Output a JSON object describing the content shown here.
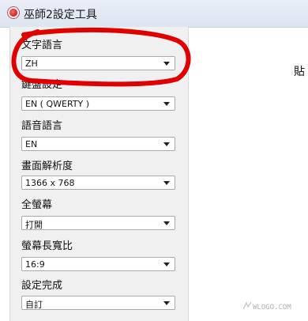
{
  "window": {
    "title": "巫師2設定工具"
  },
  "settings": [
    {
      "label": "文字語言",
      "value": "ZH"
    },
    {
      "label": "鍵盤設定",
      "value": "EN ( QWERTY )"
    },
    {
      "label": "語音語言",
      "value": "EN"
    },
    {
      "label": "畫面解析度",
      "value": "1366 x 768"
    },
    {
      "label": "全螢幕",
      "value": "打開"
    },
    {
      "label": "螢幕長寬比",
      "value": "16:9"
    },
    {
      "label": "設定完成",
      "value": "自訂"
    }
  ],
  "side": {
    "text": "貼"
  },
  "watermark": {
    "text": "WLOGO.COM"
  },
  "colors": {
    "annotation": "#e00000",
    "titlebar": "#dde5f0",
    "panel": "#f0f0f0"
  }
}
